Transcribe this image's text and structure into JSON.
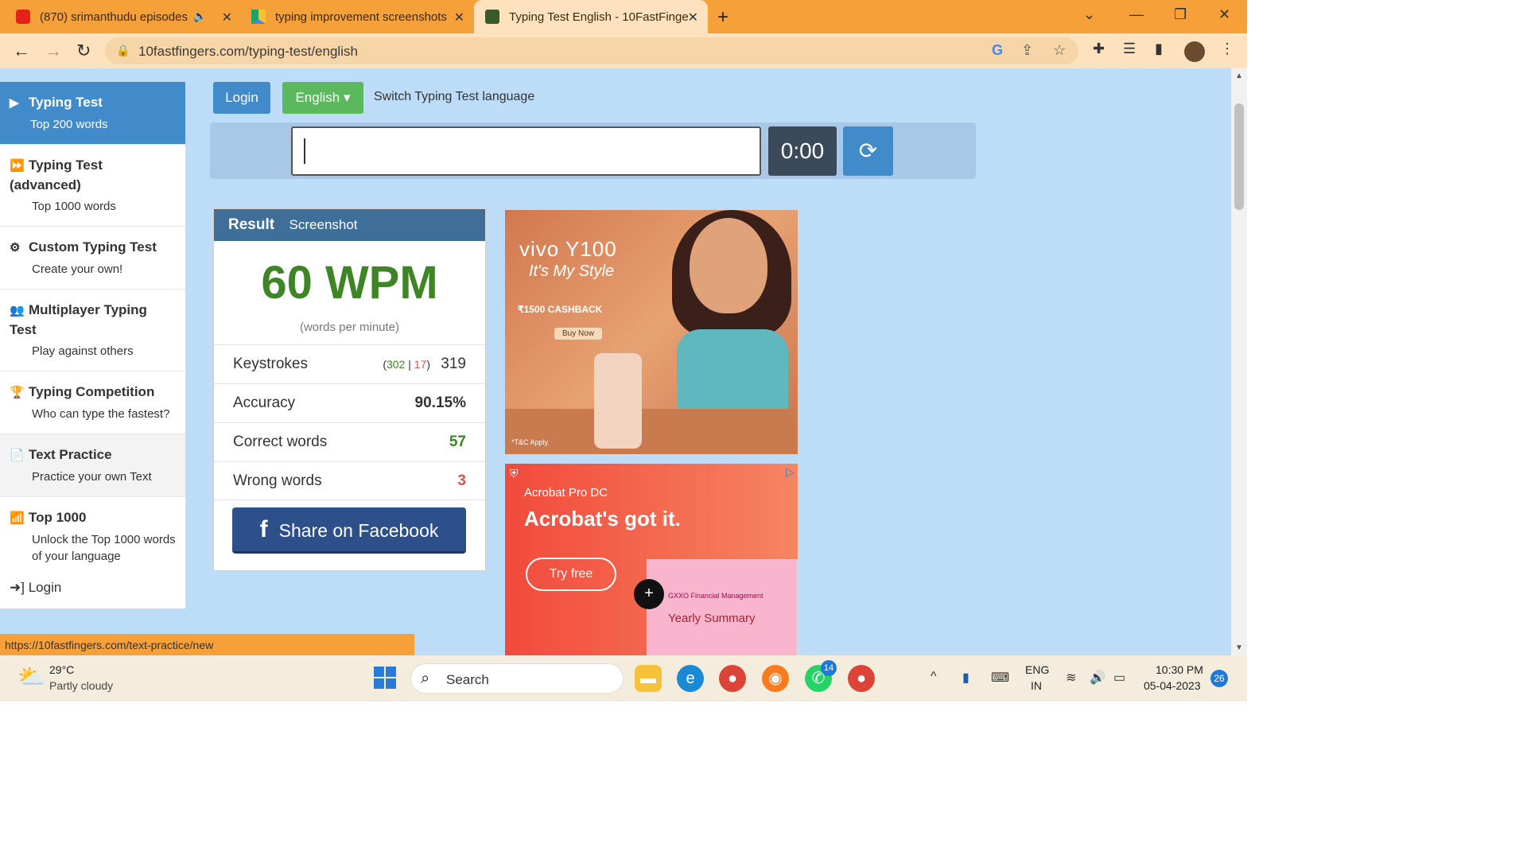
{
  "browser": {
    "tabs": [
      {
        "title": "(870) srimanthudu episodes",
        "icon": "youtube-icon"
      },
      {
        "title": "typing improvement screenshots",
        "icon": "google-drive-icon"
      },
      {
        "title": "Typing Test English - 10FastFinge",
        "icon": "10fastfingers-icon"
      }
    ],
    "url": "10fastfingers.com/typing-test/english",
    "status_url": "https://10fastfingers.com/text-practice/new"
  },
  "sidebar": {
    "items": [
      {
        "title": "Typing Test",
        "sub": "Top 200 words",
        "icon": "▶"
      },
      {
        "title": "Typing Test (advanced)",
        "sub": "Top 1000 words",
        "icon": "⏩"
      },
      {
        "title": "Custom Typing Test",
        "sub": "Create your own!",
        "icon": "⚙"
      },
      {
        "title": "Multiplayer Typing Test",
        "sub": "Play against others",
        "icon": "👥"
      },
      {
        "title": "Typing Competition",
        "sub": "Who can type the fastest?",
        "icon": "🏆"
      },
      {
        "title": "Text Practice",
        "sub": "Practice your own Text",
        "icon": "📄"
      },
      {
        "title": "Top 1000",
        "sub": "Unlock the Top 1000 words of your language",
        "icon": "📶"
      }
    ],
    "login": "Login"
  },
  "controls": {
    "login": "Login",
    "language": "English",
    "switch_text": "Switch Typing Test language",
    "timer": "0:00"
  },
  "result": {
    "tab_result": "Result",
    "tab_screenshot": "Screenshot",
    "wpm": "60 WPM",
    "wpm_sub": "(words per minute)",
    "keystrokes_label": "Keystrokes",
    "keystrokes_correct": "302",
    "keystrokes_wrong": "17",
    "keystrokes_total": "319",
    "accuracy_label": "Accuracy",
    "accuracy": "90.15%",
    "correct_label": "Correct words",
    "correct": "57",
    "wrong_label": "Wrong words",
    "wrong": "3",
    "share": "Share on Facebook"
  },
  "ads": {
    "ad1_title": "vivo Y100",
    "ad1_slogan": "It's My Style",
    "ad1_offer": "₹1500 CASHBACK",
    "ad1_buy": "Buy Now",
    "ad1_tc": "*T&C Apply.",
    "ad2_brand": "Acrobat Pro DC",
    "ad2_headline": "Acrobat's got it.",
    "ad2_cta": "Try free",
    "ad2_doc_title": "GXXO Financial Management",
    "ad2_doc_sub": "Yearly Summary"
  },
  "taskbar": {
    "temp": "29°C",
    "weather": "Partly cloudy",
    "search": "Search",
    "lang_top": "ENG",
    "lang_bottom": "IN",
    "time": "10:30 PM",
    "date": "05-04-2023",
    "notifications": "26",
    "whatsapp_badge": "14"
  }
}
